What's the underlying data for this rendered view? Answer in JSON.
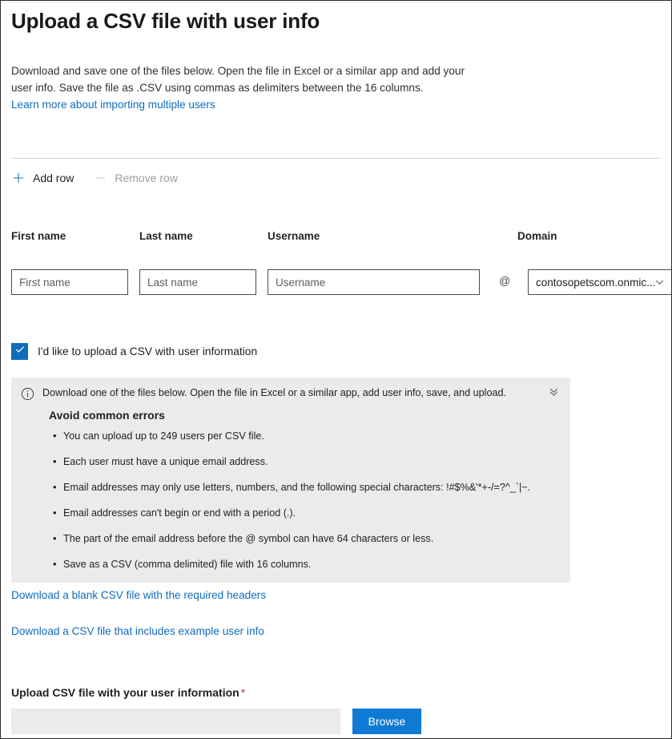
{
  "page": {
    "title": "Upload a CSV file with user info",
    "intro": "Download and save one of the files below. Open the file in Excel or a similar app and add your user info. Save the file as .CSV using commas as delimiters between the 16 columns.",
    "intro_link": "Learn more about importing multiple users"
  },
  "command_bar": {
    "add_row": "Add row",
    "remove_row": "Remove row",
    "add_icon": "plus-icon",
    "remove_icon": "minus-icon"
  },
  "user_row": {
    "labels": {
      "first_name": "First name",
      "last_name": "Last name",
      "username": "Username",
      "domain": "Domain"
    },
    "placeholders": {
      "first_name": "First name",
      "last_name": "Last name",
      "username": "Username"
    },
    "values": {
      "first_name": "",
      "last_name": "",
      "username": ""
    },
    "at_symbol": "@",
    "domain_selected": "contosopetscom.onmic...",
    "domain_caret_icon": "chevron-down-icon"
  },
  "upload_checkbox": {
    "label": "I'd like to upload a CSV with user information",
    "checked": true,
    "check_icon": "checkmark-icon"
  },
  "info_panel": {
    "icon": "info-circle-icon",
    "collapse_icon": "double-chevron-down-icon",
    "header": "Download one of the files below. Open the file in Excel or a similar app, add user info, save, and upload.",
    "subtitle": "Avoid common errors",
    "bullets": [
      "You can upload up to 249 users per CSV file.",
      "Each user must have a unique email address.",
      "Email addresses may only use letters, numbers, and the following special characters: !#$%&'*+-/=?^_`|~.",
      "Email addresses can't begin or end with a period (.).",
      "The part of the email address before the @ symbol can have 64 characters or less.",
      "Save as a CSV (comma delimited) file with 16 columns."
    ]
  },
  "downloads": {
    "blank_csv": "Download a blank CSV file with the required headers",
    "example_csv": "Download a CSV file that includes example user info"
  },
  "upload_section": {
    "label": "Upload CSV file with your user information",
    "required_marker": "*",
    "file_value": "",
    "file_placeholder": "",
    "browse_label": "Browse"
  },
  "colors": {
    "accent": "#0f6cbd",
    "button_blue": "#0f7ad4",
    "link": "#0f6cbd",
    "panel_bg": "#ebebeb",
    "required_red": "#c4314b",
    "disabled_text": "#a19f9d"
  }
}
